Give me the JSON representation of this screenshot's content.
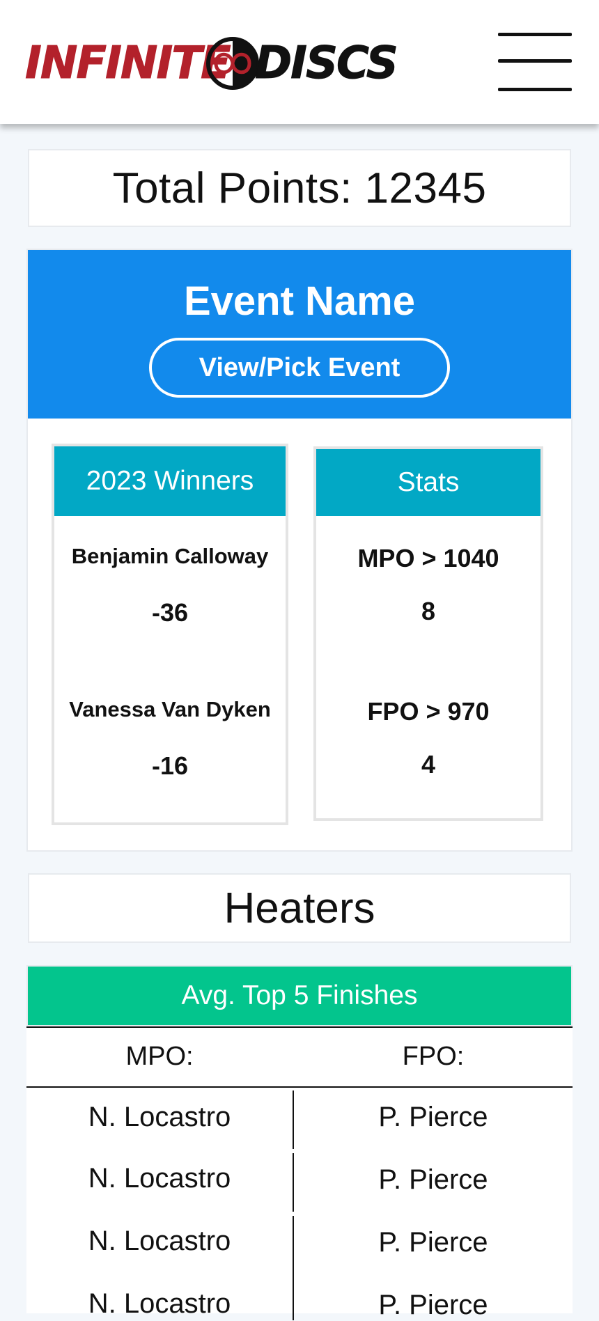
{
  "header": {
    "logo_left": "INFINITE",
    "logo_right": "DISCS",
    "logo_alt": "Infinite Discs",
    "menu_icon": "hamburger-menu-icon"
  },
  "total": {
    "label": "Total Points: 12345"
  },
  "event": {
    "name": "Event Name",
    "button_label": "View/Pick Event",
    "winners": {
      "title": "2023 Winners",
      "entries": [
        {
          "name": "Benjamin Calloway",
          "score": "-36"
        },
        {
          "name": "Vanessa Van Dyken",
          "score": "-16"
        }
      ]
    },
    "stats": {
      "title": "Stats",
      "entries": [
        {
          "label": "MPO > 1040",
          "value": "8"
        },
        {
          "label": "FPO > 970",
          "value": "4"
        }
      ]
    }
  },
  "heaters": {
    "title": "Heaters",
    "table": {
      "title": "Avg. Top 5 Finishes",
      "columns": [
        "MPO:",
        "FPO:"
      ],
      "rows": [
        [
          "N. Locastro",
          "P. Pierce"
        ],
        [
          "N. Locastro",
          "P. Pierce"
        ],
        [
          "N. Locastro",
          "P. Pierce"
        ],
        [
          "N. Locastro",
          "P. Pierce"
        ]
      ]
    }
  },
  "colors": {
    "brand_red": "#b3212b",
    "event_blue": "#128aec",
    "box_teal": "#02a8c5",
    "top5_green": "#03c58d"
  }
}
